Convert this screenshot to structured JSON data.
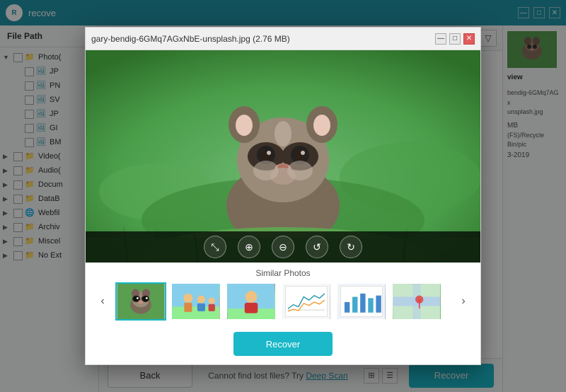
{
  "app": {
    "title": "recove",
    "window_title": "gary-bendig-6GMq7AGxNbE-unsplash.jpg (2.76 MB)",
    "logo_text": "R"
  },
  "titlebar_controls": {
    "minimize": "—",
    "maximize": "□",
    "close": "✕"
  },
  "modal_titlebar": {
    "title": "gary-bendig-6GMq7AGxNbE-unsplash.jpg (2.76 MB)",
    "minimize": "—",
    "maximize": "□",
    "close": "✕"
  },
  "sidebar": {
    "header": "File Path",
    "items": [
      {
        "label": "Photo(",
        "type": "folder",
        "expanded": true,
        "level": 0
      },
      {
        "label": "JP",
        "type": "file",
        "level": 1
      },
      {
        "label": "PN",
        "type": "file",
        "level": 1
      },
      {
        "label": "SV",
        "type": "file",
        "level": 1
      },
      {
        "label": "JP",
        "type": "file",
        "level": 1
      },
      {
        "label": "GI",
        "type": "file",
        "level": 1
      },
      {
        "label": "BM",
        "type": "file",
        "level": 1
      },
      {
        "label": "Video(",
        "type": "folder",
        "expanded": false,
        "level": 0
      },
      {
        "label": "Audio(",
        "type": "folder",
        "expanded": false,
        "level": 0
      },
      {
        "label": "Docum",
        "type": "folder",
        "expanded": false,
        "level": 0
      },
      {
        "label": "DataB",
        "type": "folder",
        "expanded": false,
        "level": 0
      },
      {
        "label": "Webfil",
        "type": "folder",
        "expanded": false,
        "level": 0
      },
      {
        "label": "Archiv",
        "type": "folder",
        "expanded": false,
        "level": 0
      },
      {
        "label": "Miscel",
        "type": "folder",
        "expanded": false,
        "level": 0
      },
      {
        "label": "No Ext",
        "type": "folder",
        "expanded": false,
        "level": 0
      }
    ]
  },
  "toolbar": {
    "search_placeholder": "",
    "filter_icon": "▽"
  },
  "image_tools": {
    "fit": "⤡",
    "zoom_in": "⊕",
    "zoom_out": "⊖",
    "rotate_left": "↺",
    "rotate_right": "↻"
  },
  "similar_photos": {
    "label": "Similar Photos",
    "nav_prev": "‹",
    "nav_next": "›",
    "thumbnails": [
      {
        "type": "raccoon",
        "active": true
      },
      {
        "type": "family",
        "active": false
      },
      {
        "type": "redshirt",
        "active": false
      },
      {
        "type": "chart",
        "active": false
      },
      {
        "type": "graph",
        "active": false
      },
      {
        "type": "map",
        "active": false
      }
    ]
  },
  "modal_recover": {
    "label": "Recover"
  },
  "right_panel": {
    "view_label": "view",
    "filename": "bendig-6GMq7AGx\nunsplash.jpg",
    "size": "MB",
    "path": "(FS)/Recycle Bin/pic",
    "date": "3-2019"
  },
  "bottom_bar": {
    "back_label": "Back",
    "info_text": "Cannot find lost files? Try ",
    "deep_scan_label": "Deep Scan",
    "recover_label": "Recover"
  },
  "view_toggles": {
    "grid_icon": "⊞",
    "list_icon": "☰"
  }
}
